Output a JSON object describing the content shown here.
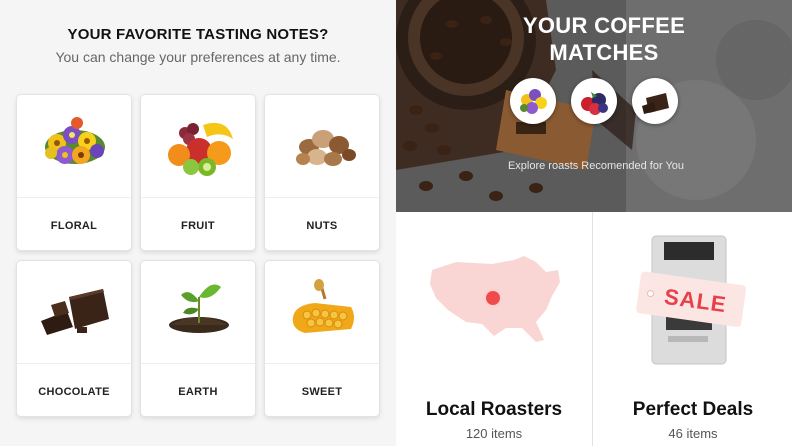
{
  "preferences": {
    "title": "YOUR FAVORITE TASTING NOTES?",
    "subtitle": "You can change your preferences at any time.",
    "notes": [
      {
        "label": "FLORAL",
        "icon": "flowers-icon"
      },
      {
        "label": "FRUIT",
        "icon": "fruit-icon"
      },
      {
        "label": "NUTS",
        "icon": "nuts-icon"
      },
      {
        "label": "CHOCOLATE",
        "icon": "chocolate-icon"
      },
      {
        "label": "EARTH",
        "icon": "sprout-icon"
      },
      {
        "label": "SWEET",
        "icon": "honeycomb-icon"
      }
    ]
  },
  "matches": {
    "title": "YOUR COFFEE MATCHES",
    "subtitle": "Explore roasts Recomended for You",
    "icons": [
      "flowers-icon",
      "berries-icon",
      "chocolate-icon"
    ]
  },
  "tiles": [
    {
      "name": "Local Roasters",
      "count": "120 items",
      "icon": "usa-map-icon"
    },
    {
      "name": "Perfect Deals",
      "count": "46 items",
      "icon": "sale-bag-icon",
      "badge": "SALE"
    }
  ],
  "colors": {
    "sale_red": "#e8404a",
    "map_pink": "#f8d6d6",
    "map_dot": "#ef4b4b"
  }
}
